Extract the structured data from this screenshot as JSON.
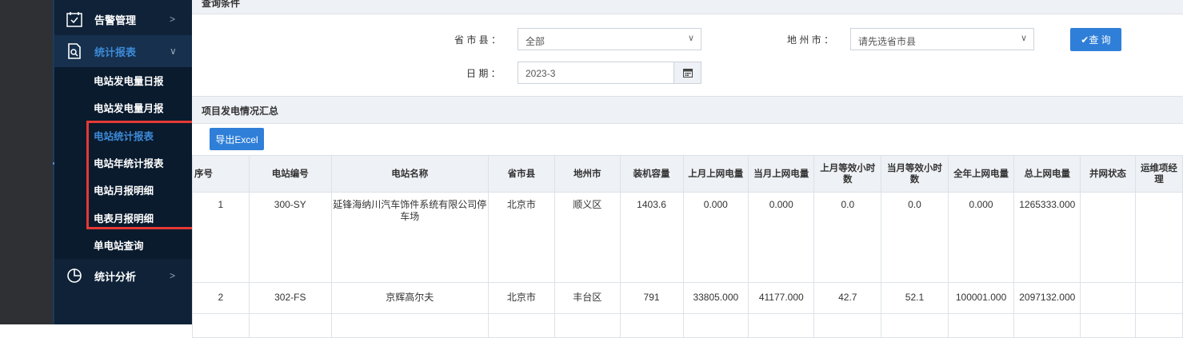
{
  "sidebar": {
    "menu": [
      {
        "label": "告警管理",
        "icon": "calendar-check-icon"
      },
      {
        "label": "统计报表",
        "icon": "report-doc-icon"
      },
      {
        "label": "统计分析",
        "icon": "pie-chart-icon"
      }
    ],
    "submenu": [
      "电站发电量日报",
      "电站发电量月报",
      "电站统计报表",
      "电站年统计报表",
      "电站月报明细",
      "电表月报明细",
      "单电站查询"
    ]
  },
  "query": {
    "section_title": "查询条件",
    "province_label": "省 市 县 ：",
    "province_value": "全部",
    "city_label": "地 州 市 ：",
    "city_value": "请先选省市县",
    "date_label": "日 期 ：",
    "date_value": "2023-3",
    "query_button": "✔查 询"
  },
  "summary": {
    "section_title": "项目发电情况汇总",
    "export_button": "导出Excel"
  },
  "table": {
    "headers": [
      "序号",
      "电站编号",
      "电站名称",
      "省市县",
      "地州市",
      "装机容量",
      "上月上网电量",
      "当月上网电量",
      "上月等效小时数",
      "当月等效小时数",
      "全年上网电量",
      "总上网电量",
      "并网状态",
      "运维项经理"
    ],
    "rows": [
      [
        "1",
        "300-SY",
        "延锋海纳川汽车饰件系统有限公司停车场",
        "北京市",
        "顺义区",
        "1403.6",
        "0.000",
        "0.000",
        "0.0",
        "0.0",
        "0.000",
        "1265333.000",
        "",
        ""
      ],
      [
        "2",
        "302-FS",
        "京辉高尔夫",
        "北京市",
        "丰台区",
        "791",
        "33805.000",
        "41177.000",
        "42.7",
        "52.1",
        "100001.000",
        "2097132.000",
        "",
        ""
      ]
    ]
  }
}
